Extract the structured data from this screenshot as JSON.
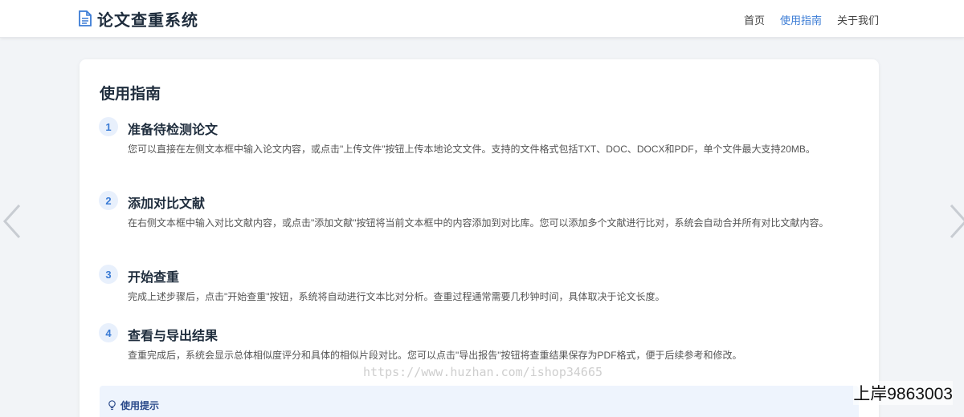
{
  "header": {
    "brand_icon": "document-icon",
    "brand_title": "论文查重系统",
    "nav": [
      {
        "label": "首页",
        "active": false
      },
      {
        "label": "使用指南",
        "active": true
      },
      {
        "label": "关于我们",
        "active": false
      }
    ]
  },
  "carousel": {
    "prev_icon": "chevron-left-icon",
    "next_icon": "chevron-right-icon"
  },
  "guide": {
    "title": "使用指南",
    "steps": [
      {
        "num": "1",
        "title": "准备待检测论文",
        "desc": "您可以直接在左侧文本框中输入论文内容，或点击\"上传文件\"按钮上传本地论文文件。支持的文件格式包括TXT、DOC、DOCX和PDF，单个文件最大支持20MB。"
      },
      {
        "num": "2",
        "title": "添加对比文献",
        "desc": "在右侧文本框中输入对比文献内容，或点击\"添加文献\"按钮将当前文本框中的内容添加到对比库。您可以添加多个文献进行比对，系统会自动合并所有对比文献内容。"
      },
      {
        "num": "3",
        "title": "开始查重",
        "desc": "完成上述步骤后，点击\"开始查重\"按钮，系统将自动进行文本比对分析。查重过程通常需要几秒钟时间，具体取决于论文长度。"
      },
      {
        "num": "4",
        "title": "查看与导出结果",
        "desc": "查重完成后，系统会显示总体相似度评分和具体的相似片段对比。您可以点击\"导出报告\"按钮将查重结果保存为PDF格式，便于后续参考和修改。"
      }
    ],
    "tip": {
      "icon": "lightbulb-icon",
      "label": "使用提示"
    }
  },
  "overlay": {
    "watermark": "https://www.huzhan.com/ishop34665",
    "corner_tag": "上岸9863003"
  },
  "colors": {
    "accent": "#3a7bd5",
    "tip_bg": "#eef4fd",
    "page_bg": "#f2f4f7"
  }
}
